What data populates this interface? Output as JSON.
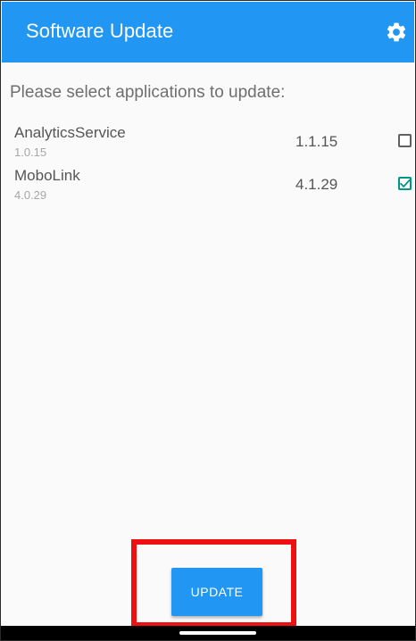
{
  "app_bar": {
    "title": "Software Update",
    "icon": "gear-icon",
    "color": "#2196f3"
  },
  "prompt": "Please select applications to update:",
  "apps": [
    {
      "name": "AnalyticsService",
      "current_version": "1.0.15",
      "new_version": "1.1.15",
      "selected": false
    },
    {
      "name": "MoboLink",
      "current_version": "4.0.29",
      "new_version": "4.1.29",
      "selected": true
    }
  ],
  "update_button": {
    "label": "UPDATE",
    "color": "#2196f3"
  },
  "highlight_color": "#ee1111",
  "checkbox_checked_color": "#009688"
}
